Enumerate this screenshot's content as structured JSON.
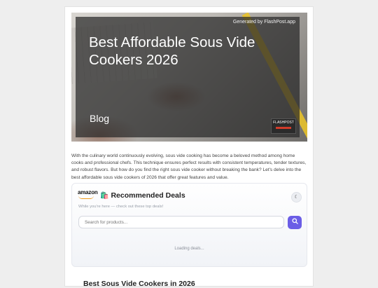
{
  "hero": {
    "generated_by": "Generated by FlashPost.app",
    "title": "Best Affordable Sous Vide Cookers 2026",
    "label": "Blog",
    "badge_text": "FLASHPOST"
  },
  "intro": "With the culinary world continuously evolving, sous vide cooking has become a beloved method among home cooks and professional chefs. This technique ensures perfect results with consistent temperatures, tender textures, and robust flavors. But how do you find the right sous vide cooker without breaking the bank? Let's delve into the best affordable sous vide cookers of 2026 that offer great features and value.",
  "deals": {
    "brand": "amazon",
    "title": "Recommended Deals",
    "title_icon": "🛍️",
    "subtitle": "While you're here — check out these top deals!",
    "search_placeholder": "Search for products...",
    "loading": "Loading deals...",
    "theme_icon": "moon-icon",
    "search_icon": "search-icon"
  },
  "section_title": "Best Sous Vide Cookers in 2026"
}
